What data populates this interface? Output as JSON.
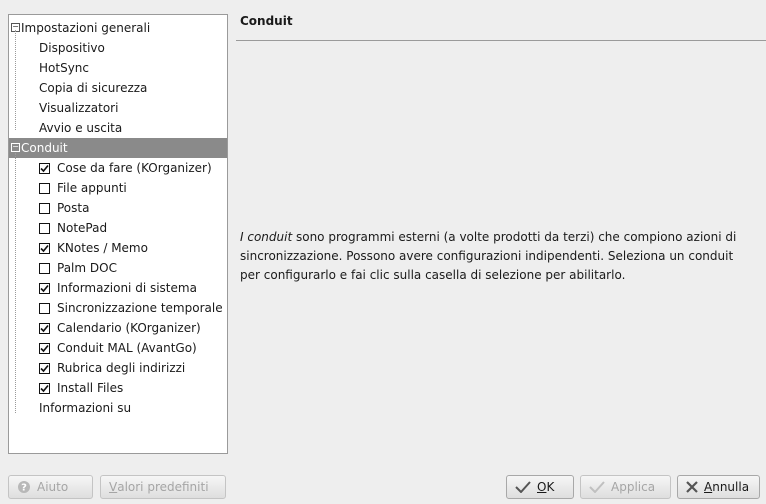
{
  "tree": {
    "items": [
      {
        "label": "Impostazioni generali",
        "level": 0,
        "expander": "⊟"
      },
      {
        "label": "Dispositivo",
        "level": 1
      },
      {
        "label": "HotSync",
        "level": 1
      },
      {
        "label": "Copia di sicurezza",
        "level": 1
      },
      {
        "label": "Visualizzatori",
        "level": 1
      },
      {
        "label": "Avvio e uscita",
        "level": 1
      },
      {
        "label": "Conduit",
        "level": 0,
        "expander": "⊟",
        "selected": true
      },
      {
        "label": "Cose da fare (KOrganizer)",
        "level": 2,
        "checked": true
      },
      {
        "label": "File appunti",
        "level": 2,
        "checked": false
      },
      {
        "label": "Posta",
        "level": 2,
        "checked": false
      },
      {
        "label": "NotePad",
        "level": 2,
        "checked": false
      },
      {
        "label": "KNotes / Memo",
        "level": 2,
        "checked": true
      },
      {
        "label": "Palm DOC",
        "level": 2,
        "checked": false
      },
      {
        "label": "Informazioni di sistema",
        "level": 2,
        "checked": true
      },
      {
        "label": "Sincronizzazione temporale",
        "level": 2,
        "checked": false
      },
      {
        "label": "Calendario (KOrganizer)",
        "level": 2,
        "checked": true
      },
      {
        "label": "Conduit MAL (AvantGo)",
        "level": 2,
        "checked": true
      },
      {
        "label": "Rubrica degli indirizzi",
        "level": 2,
        "checked": true
      },
      {
        "label": "Install Files",
        "level": 2,
        "checked": true
      },
      {
        "label": "Informazioni su",
        "level": 1
      }
    ]
  },
  "panel": {
    "title": "Conduit",
    "desc_italic": "I conduit",
    "desc_rest": " sono programmi esterni (a volte prodotti da terzi) che compiono azioni di sincronizzazione. Possono avere configurazioni indipendenti. Seleziona un conduit per configurarlo e fai clic sulla casella di selezione per abilitarlo."
  },
  "buttons": {
    "help": {
      "label": "Aiuto",
      "icon": "help-icon"
    },
    "defaults": {
      "label": "Valori predefiniti",
      "mnemonic": "V",
      "rest": "alori predefiniti"
    },
    "ok": {
      "label": "OK",
      "mnemonic": "O",
      "rest": "K",
      "icon": "check-icon"
    },
    "apply": {
      "label": "Applica",
      "icon": "check-icon"
    },
    "cancel": {
      "label": "Annulla",
      "mnemonic": "A",
      "rest": "nnulla",
      "icon": "cross-icon"
    }
  }
}
